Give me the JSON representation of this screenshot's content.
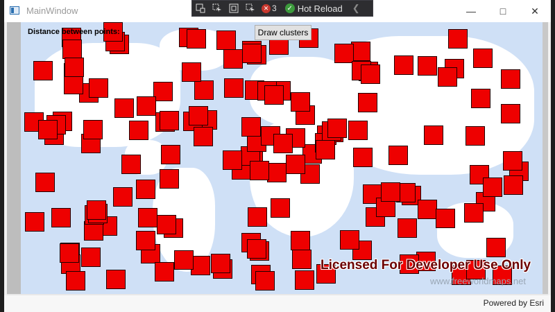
{
  "window": {
    "title": "MainWindow"
  },
  "devbar": {
    "error_count": "3",
    "hot_reload": "Hot Reload"
  },
  "toolbar": {
    "distance_label": "Distance between points:",
    "draw_clusters": "Draw clusters"
  },
  "map": {
    "license_watermark": "Licensed For Developer Use Only",
    "source_watermark": "www.freeworldmaps.net",
    "attribution": "Powered by Esri",
    "cluster_color": "#ee0000"
  }
}
